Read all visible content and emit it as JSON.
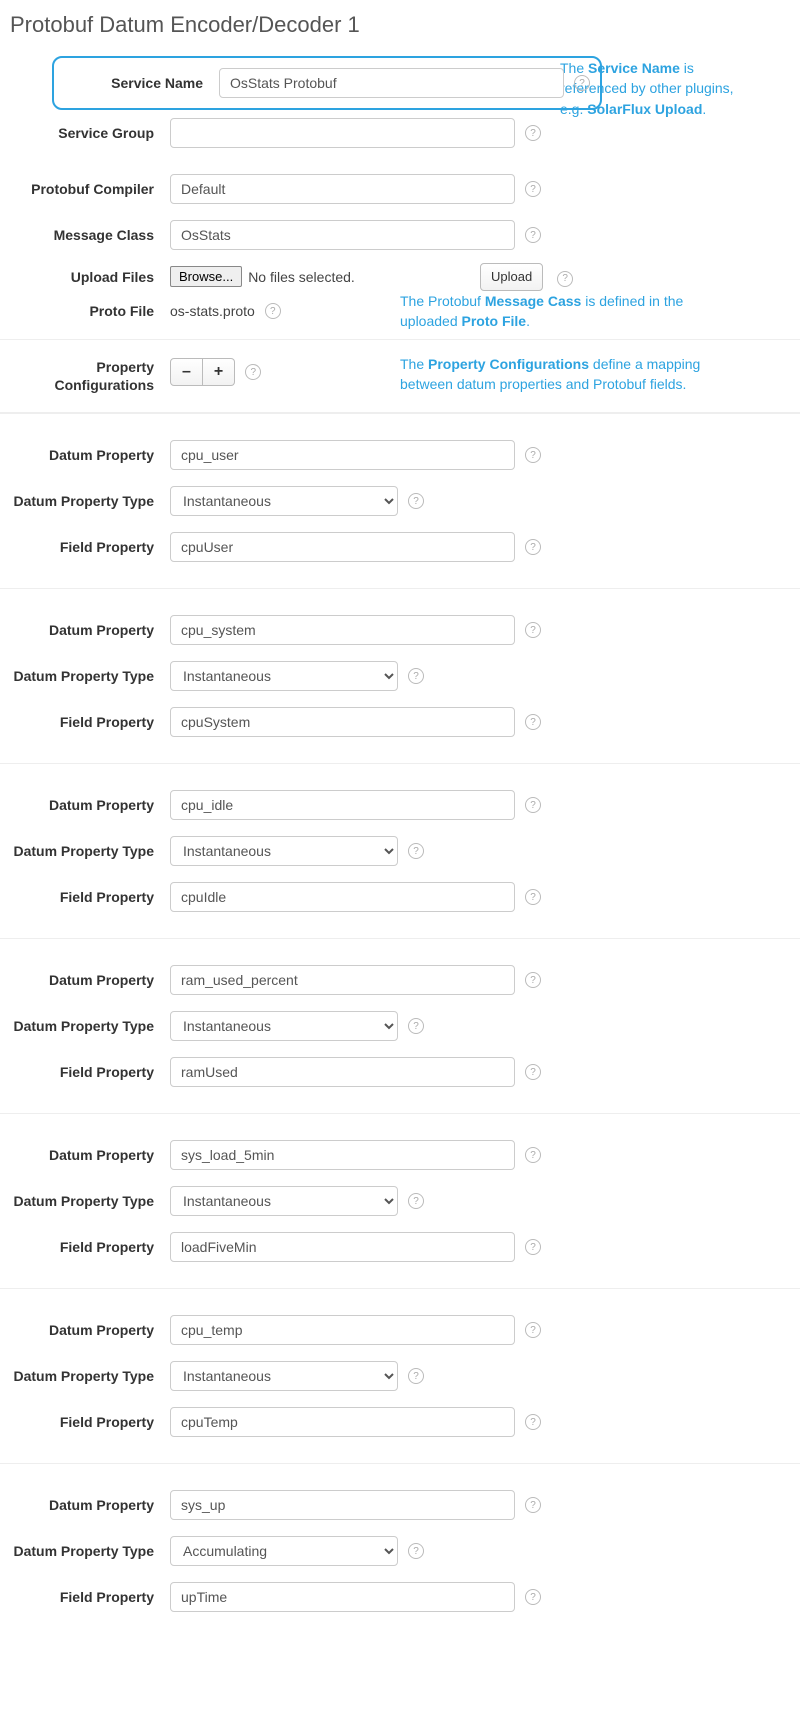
{
  "pageTitle": "Protobuf Datum Encoder/Decoder 1",
  "labels": {
    "serviceName": "Service Name",
    "serviceGroup": "Service Group",
    "protobufCompiler": "Protobuf Compiler",
    "messageClass": "Message Class",
    "uploadFiles": "Upload Files",
    "browse": "Browse...",
    "noFiles": "No files selected.",
    "upload": "Upload",
    "protoFile": "Proto File",
    "propertyConfigs": "Property Configurations",
    "minus": "–",
    "plus": "+",
    "datumProperty": "Datum Property",
    "datumPropertyType": "Datum Property Type",
    "fieldProperty": "Field Property"
  },
  "values": {
    "serviceName": "OsStats Protobuf",
    "serviceGroup": "",
    "protobufCompiler": "Default",
    "messageClass": "OsStats",
    "protoFile": "os-stats.proto"
  },
  "annotations": {
    "a1_pre": "The ",
    "a1_b1": "Service Name",
    "a1_mid": " is referenced by other plugins, e.g. ",
    "a1_b2": "SolarFlux Upload",
    "a1_end": ".",
    "a2_pre": "The Protobuf ",
    "a2_b1": "Message Cass",
    "a2_mid": " is defined in the uploaded ",
    "a2_b2": "Proto File",
    "a2_end": ".",
    "a3_pre": "The ",
    "a3_b1": "Property Configurations",
    "a3_mid": " define a mapping between datum properties and Protobuf fields."
  },
  "typeOptions": {
    "instantaneous": "Instantaneous",
    "accumulating": "Accumulating"
  },
  "props": [
    {
      "datum": "cpu_user",
      "type": "Instantaneous",
      "field": "cpuUser"
    },
    {
      "datum": "cpu_system",
      "type": "Instantaneous",
      "field": "cpuSystem"
    },
    {
      "datum": "cpu_idle",
      "type": "Instantaneous",
      "field": "cpuIdle"
    },
    {
      "datum": "ram_used_percent",
      "type": "Instantaneous",
      "field": "ramUsed"
    },
    {
      "datum": "sys_load_5min",
      "type": "Instantaneous",
      "field": "loadFiveMin"
    },
    {
      "datum": "cpu_temp",
      "type": "Instantaneous",
      "field": "cpuTemp"
    },
    {
      "datum": "sys_up",
      "type": "Accumulating",
      "field": "upTime"
    }
  ]
}
